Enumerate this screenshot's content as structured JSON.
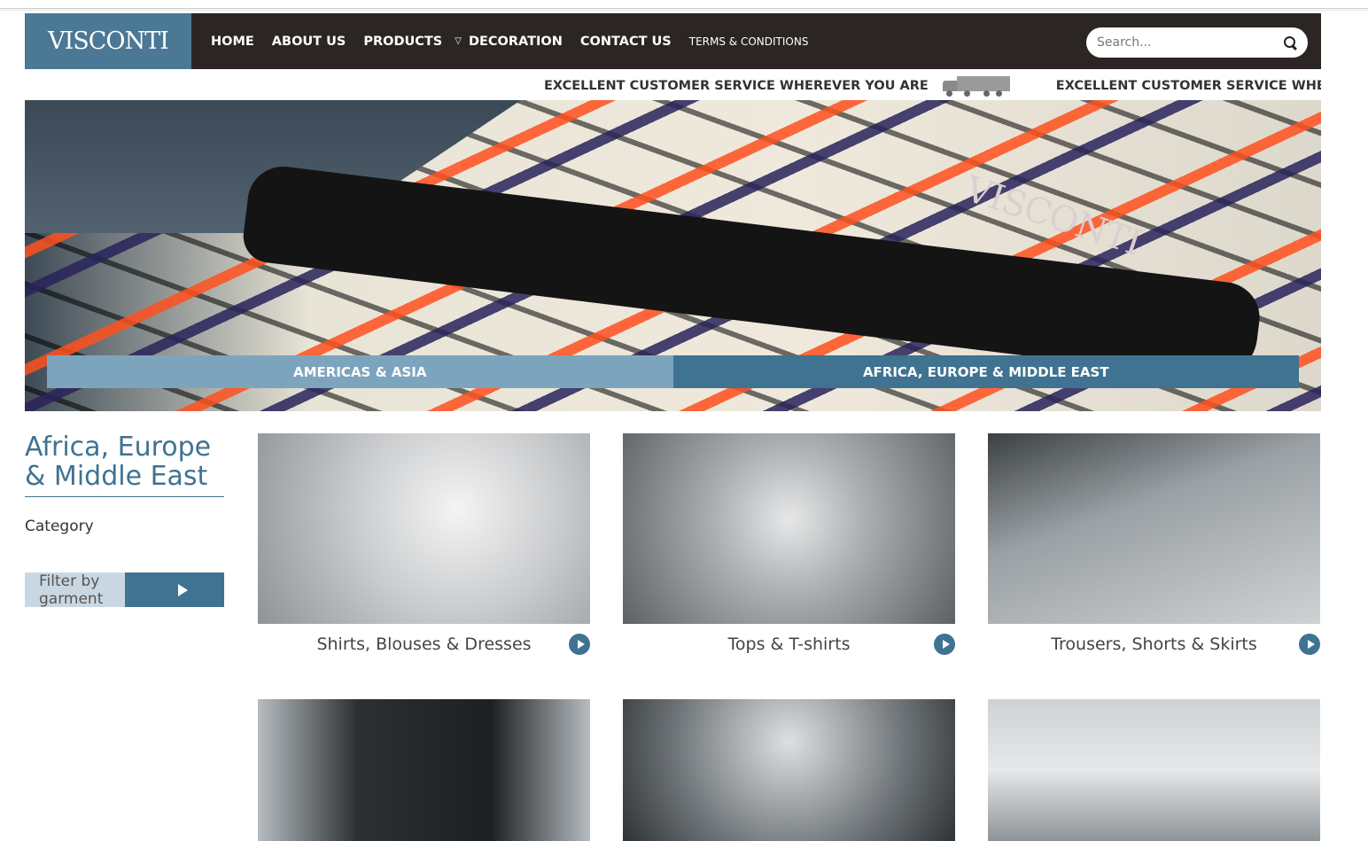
{
  "header": {
    "logo": "VISCONTI",
    "nav": [
      {
        "label": "HOME"
      },
      {
        "label": "ABOUT US"
      },
      {
        "label": "PRODUCTS"
      },
      {
        "label": "DECORATION"
      },
      {
        "label": "CONTACT US"
      },
      {
        "label": "TERMS & CONDITIONS"
      }
    ],
    "search_placeholder": "Search..."
  },
  "ticker": {
    "text": "EXCELLENT CUSTOMER SERVICE WHEREVER YOU ARE"
  },
  "hero": {
    "hanger_text": "VISCONTI",
    "regions": [
      "AMERICAS & ASIA",
      "AFRICA, EUROPE & MIDDLE EAST"
    ]
  },
  "sidebar": {
    "title_line1": "Africa, Europe",
    "title_line2": "& Middle East",
    "category_label": "Category",
    "filter_label": "Filter by garment"
  },
  "products": [
    {
      "label": "Shirts, Blouses & Dresses"
    },
    {
      "label": "Tops & T-shirts"
    },
    {
      "label": "Trousers, Shorts & Skirts"
    },
    {
      "label": ""
    },
    {
      "label": ""
    },
    {
      "label": ""
    }
  ],
  "colors": {
    "brand_blue": "#3f7391",
    "light_blue": "#7da4bd",
    "header_dark": "#2b2623"
  }
}
